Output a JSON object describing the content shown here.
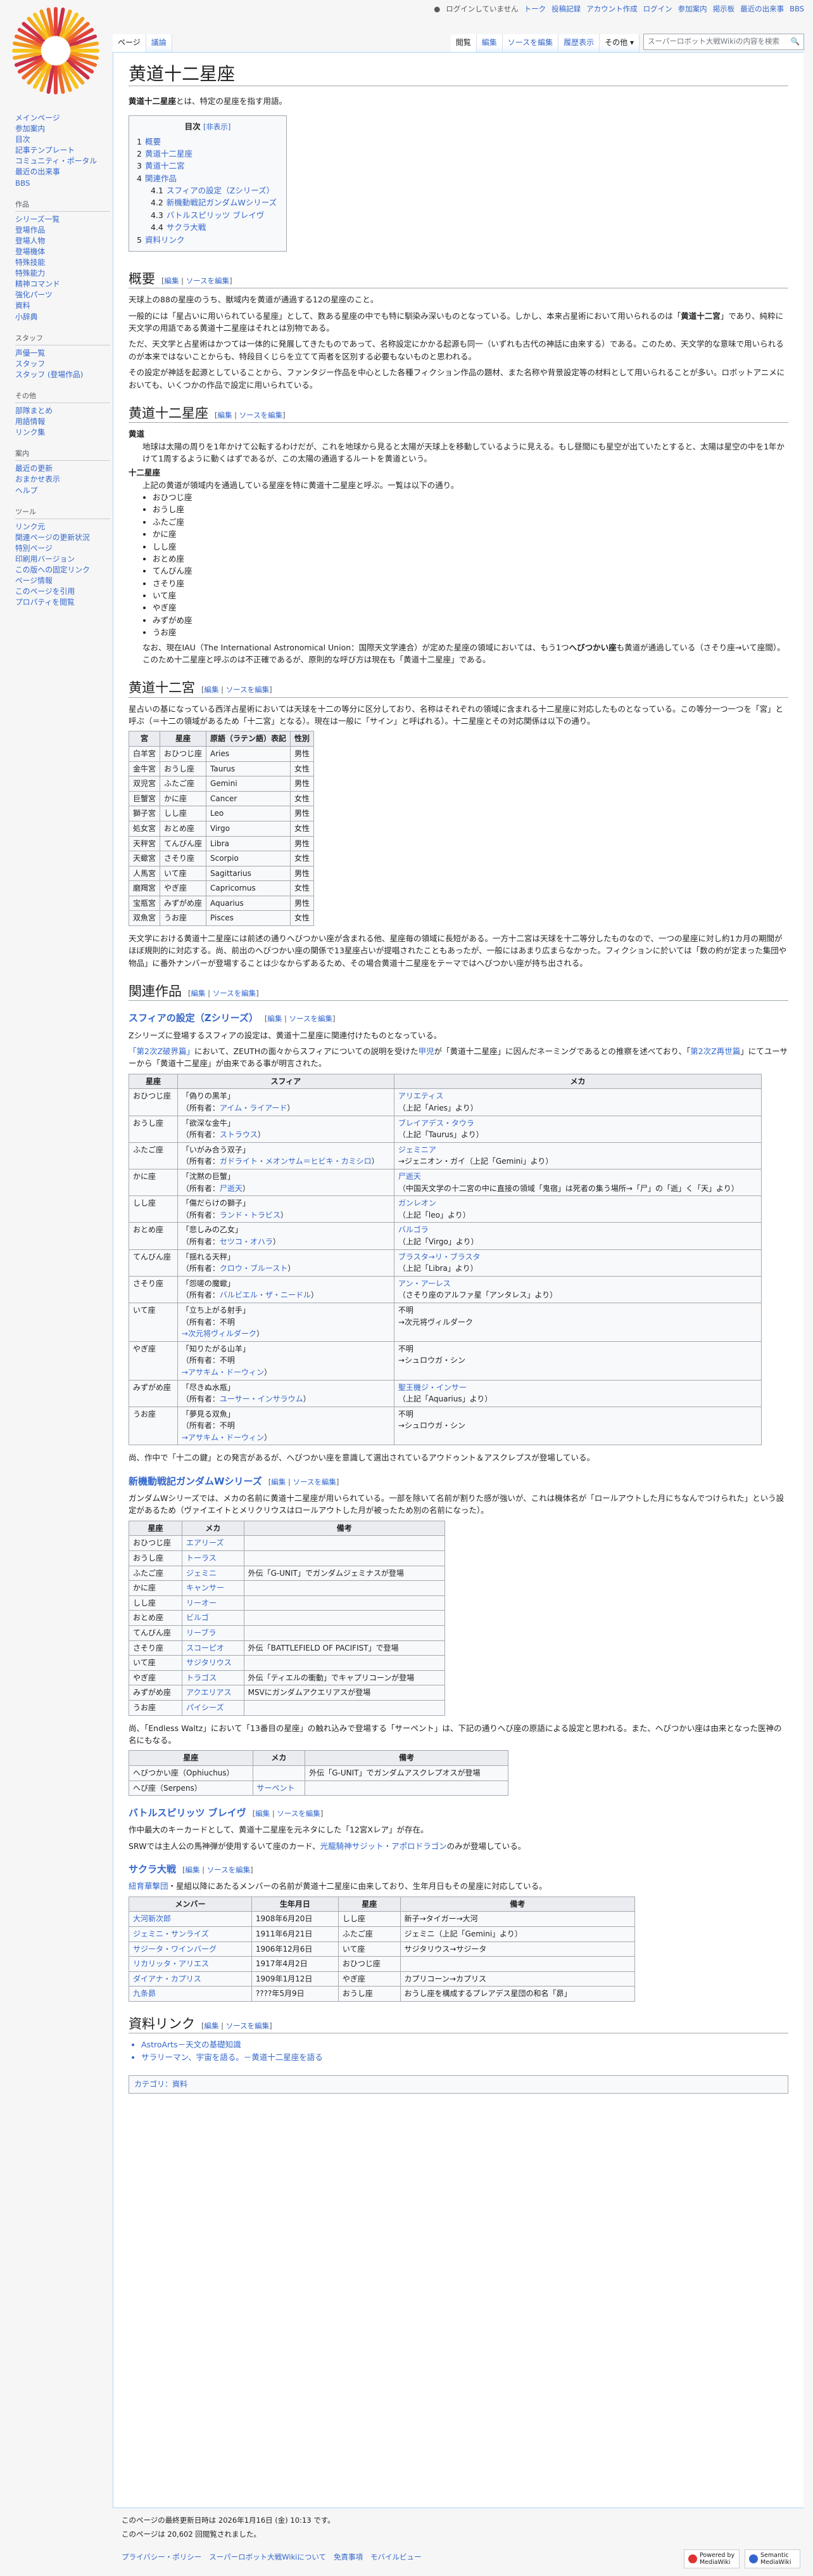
{
  "personal": [
    "ログインしていません",
    "トーク",
    "投稿記録",
    "アカウント作成",
    "ログイン",
    "参加案内",
    "掲示板",
    "最近の出来事",
    "BBS"
  ],
  "tabs": {
    "page": "ページ",
    "talk": "議論",
    "read": "閲覧",
    "edit": "編集",
    "source": "ソースを編集",
    "history": "履歴表示",
    "more": "その他 ▾"
  },
  "search_placeholder": "スーパーロボット大戦Wikiの内容を検索",
  "sidebar": {
    "nav": [
      "メインページ",
      "参加案内",
      "目次",
      "記事テンプレート",
      "コミュニティ・ポータル",
      "最近の出来事",
      "BBS"
    ],
    "s1": {
      "title": "作品",
      "items": [
        "シリーズ一覧",
        "登場作品",
        "登場人物",
        "登場機体",
        "特殊技能",
        "特殊能力",
        "精神コマンド",
        "強化パーツ",
        "資料",
        "小辞典"
      ]
    },
    "s2": {
      "title": "スタッフ",
      "items": [
        "声優一覧",
        "スタッフ",
        "スタッフ (登場作品)"
      ]
    },
    "s3": {
      "title": "その他",
      "items": [
        "部隊まとめ",
        "用語情報",
        "リンク集"
      ]
    },
    "s4": {
      "title": "案内",
      "items": [
        "最近の更新",
        "おまかせ表示",
        "ヘルプ"
      ]
    },
    "s5": {
      "title": "ツール",
      "items": [
        "リンク元",
        "関連ページの更新状況",
        "特別ページ",
        "印刷用バージョン",
        "この版への固定リンク",
        "ページ情報",
        "このページを引用",
        "プロパティを閲覧"
      ]
    }
  },
  "article": {
    "title": "黄道十二星座",
    "lead_bold": "黄道十二星座",
    "lead_rest": "とは、特定の星座を指す用語。",
    "toc_title": "目次",
    "toc_hide": "[非表示]",
    "toc": [
      {
        "n": "1",
        "t": "概要",
        "sub": false
      },
      {
        "n": "2",
        "t": "黄道十二星座",
        "sub": false
      },
      {
        "n": "3",
        "t": "黄道十二宮",
        "sub": false
      },
      {
        "n": "4",
        "t": "関連作品",
        "sub": false
      },
      {
        "n": "4.1",
        "t": "スフィアの設定（Zシリーズ）",
        "sub": true
      },
      {
        "n": "4.2",
        "t": "新機動戦記ガンダムWシリーズ",
        "sub": true
      },
      {
        "n": "4.3",
        "t": "バトルスピリッツ ブレイヴ",
        "sub": true
      },
      {
        "n": "4.4",
        "t": "サクラ大戦",
        "sub": true
      },
      {
        "n": "5",
        "t": "資料リンク",
        "sub": false
      }
    ],
    "edit_open": "[",
    "edit_label": "編集",
    "edit_sep": "|",
    "edit_source": "ソースを編集",
    "edit_close": "]",
    "h_overview": "概要",
    "ov_p1": "天球上の88の星座のうち、獣域内を黄道が通過する12の星座のこと。",
    "ov_p2a": "一般的には「星占いに用いられている星座」として、数ある星座の中でも特に馴染み深いものとなっている。しかし、本来占星術において用いられるのは「",
    "ov_p2b": "黄道十二宮",
    "ov_p2c": "」であり、純粋に天文学の用語である黄道十二星座はそれとは別物である。",
    "ov_p3": "ただ、天文学と占星術はかつては一体的に発展してきたものであって、名称設定にかかる起源も同一（いずれも古代の神話に由来する）である。このため、天文学的な意味で用いられるのが本来ではないことからも、特段目くじらを立てて両者を区別する必要もないものと思われる。",
    "ov_p4": "その設定が神話を起源としていることから、ファンタジー作品を中心とした各種フィクション作品の題材、また名称や背景設定等の材料として用いられることが多い。ロボットアニメにおいても、いくつかの作品で設定に用いられている。",
    "h_zodiac": "黄道十二星座",
    "dt1": "黄道",
    "dd1": "地球は太陽の周りを1年かけて公転するわけだが、これを地球から見ると太陽が天球上を移動しているように見える。もし昼間にも星空が出ていたとすると、太陽は星空の中を1年かけて1周するように動くはずであるが、この太陽の通過するルートを黄道という。",
    "dt2": "十二星座",
    "dd2": "上記の黄道が領域内を通過している星座を特に黄道十二星座と呼ぶ。一覧は以下の通り。",
    "constellations": [
      "おひつじ座",
      "おうし座",
      "ふたご座",
      "かに座",
      "しし座",
      "おとめ座",
      "てんびん座",
      "さそり座",
      "いて座",
      "やぎ座",
      "みずがめ座",
      "うお座"
    ],
    "zod_note_a": "なお、現在IAU（The International Astronomical Union：国際天文学連合）が定めた星座の領域においては、もう1つ",
    "zod_note_b": "へびつかい座",
    "zod_note_c": "も黄道が通過している（さそり座→いて座間）。このため十二星座と呼ぶのは不正確であるが、原則的な呼び方は現在も「黄道十二星座」である。",
    "h_palace": "黄道十二宮",
    "pal_p1": "星占いの基になっている西洋占星術においては天球を十二の等分に区分しており、名称はそれぞれの領域に含まれる十二星座に対応したものとなっている。この等分一つ一つを「宮」と呼ぶ（＝十二の領域があるため「十二宮」となる）。現在は一般に「サイン」と呼ばれる）。十二星座とその対応関係は以下の通り。",
    "palace_headers": [
      "宮",
      "星座",
      "原語（ラテン語）表記",
      "性別"
    ],
    "palace_rows": [
      [
        "白羊宮",
        "おひつじ座",
        "Aries",
        "男性"
      ],
      [
        "金牛宮",
        "おうし座",
        "Taurus",
        "女性"
      ],
      [
        "双児宮",
        "ふたご座",
        "Gemini",
        "男性"
      ],
      [
        "巨蟹宮",
        "かに座",
        "Cancer",
        "女性"
      ],
      [
        "獅子宮",
        "しし座",
        "Leo",
        "男性"
      ],
      [
        "処女宮",
        "おとめ座",
        "Virgo",
        "女性"
      ],
      [
        "天秤宮",
        "てんびん座",
        "Libra",
        "男性"
      ],
      [
        "天蠍宮",
        "さそり座",
        "Scorpio",
        "女性"
      ],
      [
        "人馬宮",
        "いて座",
        "Sagittarius",
        "男性"
      ],
      [
        "磨羯宮",
        "やぎ座",
        "Capricornus",
        "女性"
      ],
      [
        "宝瓶宮",
        "みずがめ座",
        "Aquarius",
        "男性"
      ],
      [
        "双魚宮",
        "うお座",
        "Pisces",
        "女性"
      ]
    ],
    "pal_p2": "天文学における黄道十二星座には前述の通りへびつかい座が含まれる他、星座毎の領域に長短がある。一方十二宮は天球を十二等分したものなので、一つの星座に対し約1カ月の期間がほぼ規則的に対応する。尚、前出のへびつかい座の関係で13星座占いが提唱されたこともあったが、一般にはあまり広まらなかった。フィクションに於いては「数の約が定まった集団や物品」に番外ナンバーが登場することは少なからずあるため、その場合黄道十二星座をテーマではへびつかい座が持ち出される。",
    "h_related": "関連作品",
    "h_sphere": "スフィアの設定（Zシリーズ）",
    "sph_p1": "Zシリーズに登場するスフィアの設定は、黄道十二星座に関連付けたものとなっている。",
    "sph_p2a": "「第2次Z破界篇」",
    "sph_p2b": "において、ZEUTHの面々からスフィアについての説明を受けた",
    "sph_p2c": "甲児",
    "sph_p2d": "が「黄道十二星座」に因んだネーミングであるとの推察を述べており、「",
    "sph_p2e": "第2次Z再世篇",
    "sph_p2f": "」にてユーサーから「黄道十二星座」が由来である事が明言された。",
    "sphere_headers": [
      "星座",
      "スフィア",
      "メカ"
    ],
    "sphere_rows": [
      [
        "おひつじ座",
        "「偽りの黒羊」",
        "（所有者：",
        "アイム・ライアード",
        "）",
        "アリエティス",
        "（上記「Aries」より）"
      ],
      [
        "おうし座",
        "「欲深な金牛」",
        "（所有者：",
        "ストラウス",
        "）",
        "ブレイアデス・タウラ",
        "（上記「Taurus」より）"
      ],
      [
        "ふたご座",
        "「いがみ合う双子」",
        "（所有者：",
        "ガドライト・メオンサム＝ヒビキ・カミシロ",
        "）",
        "ジェミニア",
        "→ジェニオン・ガイ（上記「Gemini」より）"
      ],
      [
        "かに座",
        "「沈黙の巨蟹」",
        "（所有者：",
        "尸逝天",
        "）",
        "尸逝天",
        "（中国天文学の十二宮の中に直接の領域「鬼宿」は死者の集う場所→「尸」の「逝」く「天」より）"
      ],
      [
        "しし座",
        "「傷だらけの獅子」",
        "（所有者：",
        "ランド・トラビス",
        "）",
        "ガンレオン",
        "（上記「leo」より）"
      ],
      [
        "おとめ座",
        "「悲しみの乙女」",
        "（所有者：",
        "セツコ・オハラ",
        "）",
        "バルゴラ",
        "（上記「Virgo」より）"
      ],
      [
        "てんびん座",
        "「揺れる天秤」",
        "（所有者：",
        "クロウ・ブルースト",
        "）",
        "ブラスタ→リ・ブラスタ",
        "（上記「Libra」より）"
      ],
      [
        "さそり座",
        "「怨嗟の魔蠍」",
        "（所有者：",
        "バルビエル・ザ・ニードル",
        "）",
        "アン・アーレス",
        "（さそり座のアルファ星「アンタレス」より）"
      ],
      [
        "いて座",
        "「立ち上がる射手」",
        "（所有者：不明",
        "",
        "→次元将ヴィルダーク）",
        "不明",
        "→次元将ヴィルダーク"
      ],
      [
        "やぎ座",
        "「知りたがる山羊」",
        "（所有者：不明",
        "",
        "→アサキム・ドーウィン）",
        "不明",
        "→シュロウガ・シン"
      ],
      [
        "みずがめ座",
        "「尽きぬ水瓶」",
        "（所有者：",
        "ユーサー・インサラウム",
        "）",
        "聖王機ジ・インサー",
        "（上記「Aquarius」より）"
      ],
      [
        "うお座",
        "「夢見る双魚」",
        "（所有者：不明",
        "",
        "→アサキム・ドーウィン）",
        "不明",
        "→シュロウガ・シン"
      ]
    ],
    "sph_p3a": "尚、作中で「十二の鍵」との発言があるが、へびつかい座を意識して選出されているアウドゥント＆アスクレプスが登場している。",
    "h_gundam": "新機動戦記ガンダムWシリーズ",
    "gw_p1": "ガンダムWシリーズでは、メカの名前に黄道十二星座が用いられている。一部を除いて名前が割りた感が強いが、これは機体名が「ロールアウトした月にちなんでつけられた」という設定があるため（ヴァイエイトとメリクリウスはロールアウトした月が被ったため別の名前になった）。",
    "gw_headers": [
      "星座",
      "メカ",
      "備考"
    ],
    "gw_rows": [
      [
        "おひつじ座",
        "エアリーズ",
        ""
      ],
      [
        "おうし座",
        "トーラス",
        ""
      ],
      [
        "ふたご座",
        "ジェミニ",
        "外伝「G-UNIT」でガンダムジェミナスが登場"
      ],
      [
        "かに座",
        "キャンサー",
        ""
      ],
      [
        "しし座",
        "リーオー",
        ""
      ],
      [
        "おとめ座",
        "ビルゴ",
        ""
      ],
      [
        "てんびん座",
        "リーブラ",
        ""
      ],
      [
        "さそり座",
        "スコーピオ",
        "外伝「BATTLEFIELD OF PACIFIST」で登場"
      ],
      [
        "いて座",
        "サジタリウス",
        ""
      ],
      [
        "やぎ座",
        "トラゴス",
        "外伝「ティエルの衝動」でキャプリコーンが登場"
      ],
      [
        "みずがめ座",
        "アクエリアス",
        "MSVにガンダムアクエリアスが登場"
      ],
      [
        "うお座",
        "パイシーズ",
        ""
      ]
    ],
    "gw_p2": "尚、「Endless Waltz」において「13番目の星座」の触れ込みで登場する「サーペント」は、下記の通りへび座の原語による設定と思われる。また、へびつかい座は由来となった医神の名にもなる。",
    "gw2_headers": [
      "星座",
      "メカ",
      "備考"
    ],
    "gw2_rows": [
      [
        "へびつかい座（Ophiuchus）",
        "",
        "外伝「G-UNIT」でガンダムアスクレプオスが登場"
      ],
      [
        "へび座（Serpens）",
        "サーペント",
        ""
      ]
    ],
    "h_battle": "バトルスピリッツ ブレイヴ",
    "bs_p1": "作中最大のキーカードとして、黄道十二星座を元ネタにした「12宮Xレア」が存在。",
    "bs_p2a": "SRWでは主人公の馬神弾が使用するいて座のカード、",
    "bs_p2b": "光龍騎神サジット・アポロドラゴン",
    "bs_p2c": "のみが登場している。",
    "h_sakura": "サクラ大戦",
    "sk_p1a": "紐育華撃団",
    "sk_p1b": "・星組以降にあたる",
    "sk_p1c": "メンバーの名前が黄道十二星座に由来しており、生年月日もその星座に対応している。",
    "sk_headers": [
      "メンバー",
      "生年月日",
      "星座",
      "備考"
    ],
    "sk_rows": [
      [
        "大河新次郎",
        "1908年6月20日",
        "しし座",
        "新子→タイガー→大河"
      ],
      [
        "ジェミニ・サンライズ",
        "1911年6月21日",
        "ふたご座",
        "ジェミニ（上記「Gemini」より）"
      ],
      [
        "サジータ・ワインバーグ",
        "1906年12月6日",
        "いて座",
        "サジタリウス→サジータ"
      ],
      [
        "リカリッタ・アリエス",
        "1917年4月2日",
        "おひつじ座",
        ""
      ],
      [
        "ダイアナ・カプリス",
        "1909年1月12日",
        "やぎ座",
        "カプリコーン→カプリス"
      ],
      [
        "九条昴",
        "????年5月9日",
        "おうし座",
        "おうし座を構成するプレアデス星団の和名「昴」"
      ]
    ],
    "h_refs": "資料リンク",
    "refs": [
      "AstroArts－天文の基礎知識",
      "サラリーマン、宇宙を語る。－黄道十二星座を語る"
    ],
    "category": "カテゴリ：資料"
  },
  "footer": {
    "modified": "このページの最終更新日時は 2026年1月16日 (金) 10:13 です。",
    "views": "このページは 20,602 回閲覧されました。",
    "links": [
      "プライバシー・ポリシー",
      "スーパーロボット大戦Wikiについて",
      "免責事項",
      "モバイルビュー"
    ],
    "badge1": "Powered by MediaWiki",
    "badge2": "Semantic MediaWiki"
  },
  "colors": {
    "link": "#3366cc",
    "redlink": "#d73333",
    "border": "#a2a9b1"
  }
}
